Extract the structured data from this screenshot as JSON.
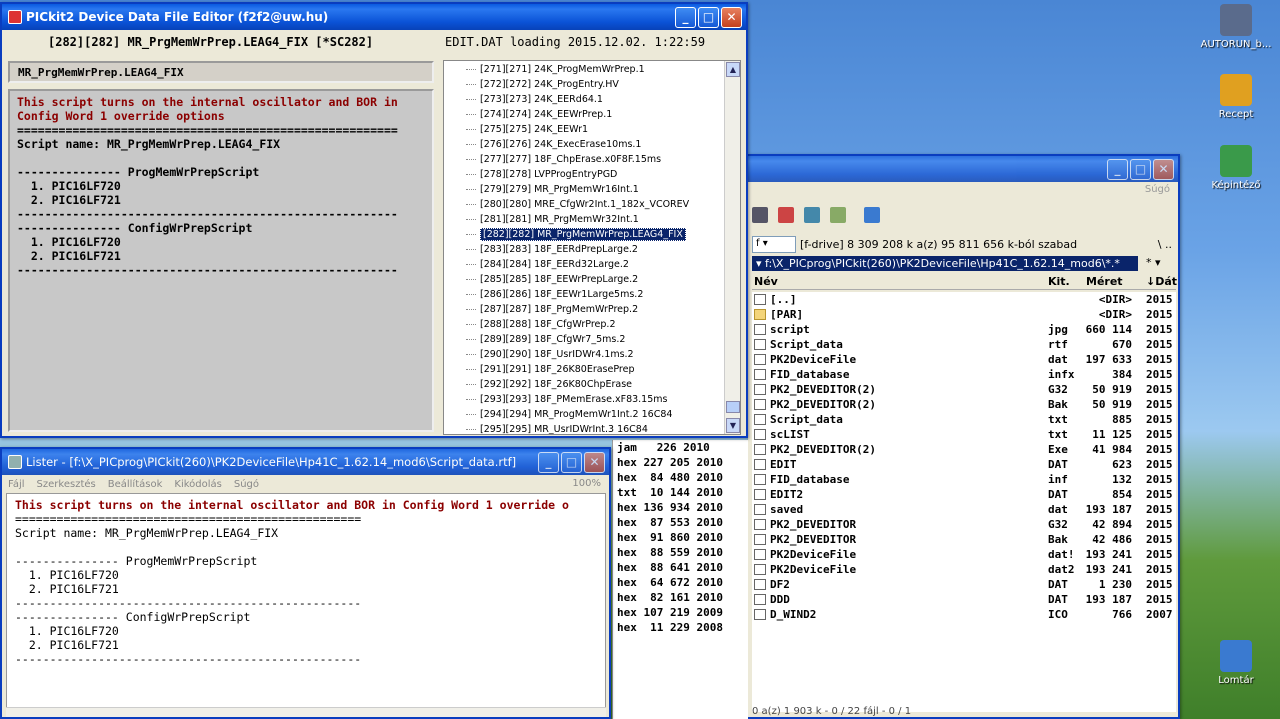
{
  "desktop_icons": [
    {
      "label": "AUTORUN_b...",
      "color": "#5a6b8c"
    },
    {
      "label": "Recept",
      "color": "#e0a020"
    },
    {
      "label": "Képintéző",
      "color": "#3a9a4a"
    },
    {
      "label": "Lomtár",
      "color": "#3a7ad0"
    }
  ],
  "editor": {
    "title": "PICkit2 Device Data File Editor (f2f2@uw.hu)",
    "header_left": "[282][282] MR_PrgMemWrPrep.LEAG4_FIX [*SC282]",
    "header_right": "EDIT.DAT loading 2015.12.02. 1:22:59",
    "name_field": "MR_PrgMemWrPrep.LEAG4_FIX",
    "script_lines": [
      {
        "text": "This script turns on the internal oscillator and BOR in",
        "red": true
      },
      {
        "text": "Config Word 1 override options",
        "red": true
      },
      {
        "text": "=======================================================",
        "red": false
      },
      {
        "text": "Script name: MR_PrgMemWrPrep.LEAG4_FIX",
        "red": false
      },
      {
        "text": "",
        "red": false
      },
      {
        "text": "--------------- ProgMemWrPrepScript",
        "red": false
      },
      {
        "text": "  1. PIC16LF720",
        "red": false
      },
      {
        "text": "  2. PIC16LF721",
        "red": false
      },
      {
        "text": "-------------------------------------------------------",
        "red": false
      },
      {
        "text": "--------------- ConfigWrPrepScript",
        "red": false
      },
      {
        "text": "  1. PIC16LF720",
        "red": false
      },
      {
        "text": "  2. PIC16LF721",
        "red": false
      },
      {
        "text": "-------------------------------------------------------",
        "red": false
      }
    ],
    "script_items": [
      {
        "label": "[271][271] 24K_ProgMemWrPrep.1",
        "selected": false
      },
      {
        "label": "[272][272] 24K_ProgEntry.HV",
        "selected": false
      },
      {
        "label": "[273][273] 24K_EERd64.1",
        "selected": false
      },
      {
        "label": "[274][274] 24K_EEWrPrep.1",
        "selected": false
      },
      {
        "label": "[275][275] 24K_EEWr1",
        "selected": false
      },
      {
        "label": "[276][276] 24K_ExecErase10ms.1",
        "selected": false
      },
      {
        "label": "[277][277] 18F_ChpErase.x0F8F.15ms",
        "selected": false
      },
      {
        "label": "[278][278] LVPProgEntryPGD",
        "selected": false
      },
      {
        "label": "[279][279] MR_PrgMemWr16Int.1",
        "selected": false
      },
      {
        "label": "[280][280] MRE_CfgWr2Int.1_182x_VCOREV",
        "selected": false
      },
      {
        "label": "[281][281] MR_PrgMemWr32Int.1",
        "selected": false
      },
      {
        "label": "[282][282] MR_PrgMemWrPrep.LEAG4_FIX",
        "selected": true
      },
      {
        "label": "[283][283] 18F_EERdPrepLarge.2",
        "selected": false
      },
      {
        "label": "[284][284] 18F_EERd32Large.2",
        "selected": false
      },
      {
        "label": "[285][285] 18F_EEWrPrepLarge.2",
        "selected": false
      },
      {
        "label": "[286][286] 18F_EEWr1Large5ms.2",
        "selected": false
      },
      {
        "label": "[287][287] 18F_PrgMemWrPrep.2",
        "selected": false
      },
      {
        "label": "[288][288] 18F_CfgWrPrep.2",
        "selected": false
      },
      {
        "label": "[289][289] 18F_CfgWr7_5ms.2",
        "selected": false
      },
      {
        "label": "[290][290] 18F_UsrIDWr4.1ms.2",
        "selected": false
      },
      {
        "label": "[291][291] 18F_26K80ErasePrep",
        "selected": false
      },
      {
        "label": "[292][292] 18F_26K80ChpErase",
        "selected": false
      },
      {
        "label": "[293][293] 18F_PMemErase.xF83.15ms",
        "selected": false
      },
      {
        "label": "[294][294] MR_ProgMemWr1Int.2 16C84",
        "selected": false
      },
      {
        "label": "[295][295] MR_UsrIDWrInt.3 16C84",
        "selected": false
      }
    ]
  },
  "lister": {
    "title": "Lister - [f:\\X_PICprog\\PICkit(260)\\PK2DeviceFile\\Hp41C_1.62.14_mod6\\Script_data.rtf]",
    "menu": [
      "Fájl",
      "Szerkesztés",
      "Beállítások",
      "Kikódolás",
      "Súgó"
    ],
    "zoom": "100%",
    "lines": [
      {
        "text": "This script turns on the internal oscillator and BOR in Config Word 1 override o",
        "red": true
      },
      {
        "text": "==================================================",
        "red": false
      },
      {
        "text": "Script name: MR_PrgMemWrPrep.LEAG4_FIX",
        "red": false
      },
      {
        "text": "",
        "red": false
      },
      {
        "text": "--------------- ProgMemWrPrepScript",
        "red": false
      },
      {
        "text": "  1. PIC16LF720",
        "red": false
      },
      {
        "text": "  2. PIC16LF721",
        "red": false
      },
      {
        "text": "--------------------------------------------------",
        "red": false
      },
      {
        "text": "--------------- ConfigWrPrepScript",
        "red": false
      },
      {
        "text": "  1. PIC16LF720",
        "red": false
      },
      {
        "text": "  2. PIC16LF721",
        "red": false
      },
      {
        "text": "--------------------------------------------------",
        "red": false
      }
    ]
  },
  "file_manager": {
    "menu_help": "Súgó",
    "drive": "f",
    "drive_info": "[f-drive]  8 309 208 k a(z) 95 811 656 k-ból szabad",
    "drive_extra": "\\  ..",
    "path": "f:\\X_PICprog\\PICkit(260)\\PK2DeviceFile\\Hp41C_1.62.14_mod6\\*.*",
    "path_extra": "*  ▾",
    "columns": {
      "name": "Név",
      "ext": "Kit.",
      "size": "Méret",
      "date": "↓Dát"
    },
    "files": [
      {
        "name": "[..]",
        "ext": "",
        "size": "<DIR>",
        "date": "2015",
        "icon": "up"
      },
      {
        "name": "[PAR]",
        "ext": "",
        "size": "<DIR>",
        "date": "2015",
        "icon": "folder"
      },
      {
        "name": "script",
        "ext": "jpg",
        "size": "660 114",
        "date": "2015",
        "icon": "file"
      },
      {
        "name": "Script_data",
        "ext": "rtf",
        "size": "670",
        "date": "2015",
        "icon": "file"
      },
      {
        "name": "PK2DeviceFile",
        "ext": "dat",
        "size": "197 633",
        "date": "2015",
        "icon": "file"
      },
      {
        "name": "FID_database",
        "ext": "infx",
        "size": "384",
        "date": "2015",
        "icon": "file"
      },
      {
        "name": "PK2_DEVEDITOR(2)",
        "ext": "G32",
        "size": "50 919",
        "date": "2015",
        "icon": "file"
      },
      {
        "name": "PK2_DEVEDITOR(2)",
        "ext": "Bak",
        "size": "50 919",
        "date": "2015",
        "icon": "file"
      },
      {
        "name": "Script_data",
        "ext": "txt",
        "size": "885",
        "date": "2015",
        "icon": "file"
      },
      {
        "name": "scLIST",
        "ext": "txt",
        "size": "11 125",
        "date": "2015",
        "icon": "file"
      },
      {
        "name": "PK2_DEVEDITOR(2)",
        "ext": "Exe",
        "size": "41 984",
        "date": "2015",
        "icon": "exe"
      },
      {
        "name": "EDIT",
        "ext": "DAT",
        "size": "623",
        "date": "2015",
        "icon": "file"
      },
      {
        "name": "FID_database",
        "ext": "inf",
        "size": "132",
        "date": "2015",
        "icon": "file"
      },
      {
        "name": "EDIT2",
        "ext": "DAT",
        "size": "854",
        "date": "2015",
        "icon": "file"
      },
      {
        "name": "saved",
        "ext": "dat",
        "size": "193 187",
        "date": "2015",
        "icon": "file"
      },
      {
        "name": "PK2_DEVEDITOR",
        "ext": "G32",
        "size": "42 894",
        "date": "2015",
        "icon": "file"
      },
      {
        "name": "PK2_DEVEDITOR",
        "ext": "Bak",
        "size": "42 486",
        "date": "2015",
        "icon": "file"
      },
      {
        "name": "PK2DeviceFile",
        "ext": "dat!",
        "size": "193 241",
        "date": "2015",
        "icon": "file"
      },
      {
        "name": "PK2DeviceFile",
        "ext": "dat2",
        "size": "193 241",
        "date": "2015",
        "icon": "file"
      },
      {
        "name": "DF2",
        "ext": "DAT",
        "size": "1 230",
        "date": "2015",
        "icon": "file"
      },
      {
        "name": "DDD",
        "ext": "DAT",
        "size": "193 187",
        "date": "2015",
        "icon": "file"
      },
      {
        "name": "D_WIND2",
        "ext": "ICO",
        "size": "766",
        "date": "2007",
        "icon": "exe"
      }
    ],
    "left_panel_rows": [
      "jam   226 2010",
      "hex 227 205 2010",
      "hex  84 480 2010",
      "txt  10 144 2010",
      "hex 136 934 2010",
      "hex  87 553 2010",
      "hex  91 860 2010",
      "hex  88 559 2010",
      "hex  88 641 2010",
      "hex  64 672 2010",
      "hex  82 161 2010",
      "hex 107 219 2009",
      "hex  11 229 2008"
    ],
    "status": "0 a(z) 1 903 k - 0 / 22 fájl - 0 / 1"
  }
}
